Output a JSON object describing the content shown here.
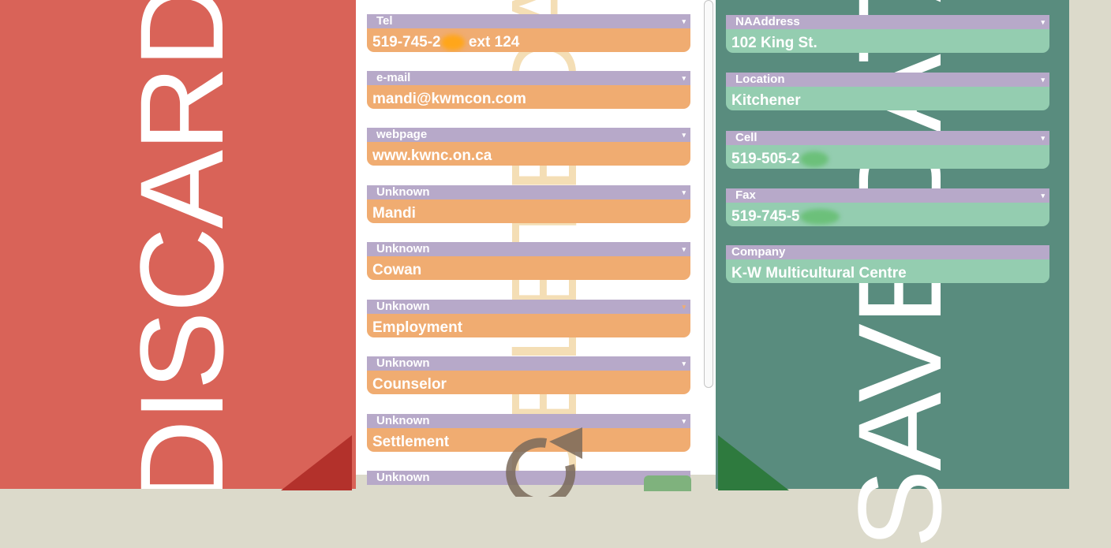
{
  "discard": {
    "label": "DISCARD"
  },
  "save": {
    "label": "SAVE DATA"
  },
  "watermark": {
    "label": "DELETE DATA"
  },
  "left_fields": [
    {
      "label": "Tel",
      "value": "519-745-2",
      "suffix": "ext 124"
    },
    {
      "label": "e-mail",
      "value": "mandi@kwmcon.com"
    },
    {
      "label": "webpage",
      "value": "www.kwnc.on.ca"
    },
    {
      "label": "Unknown",
      "value": "Mandi"
    },
    {
      "label": "Unknown",
      "value": "Cowan"
    },
    {
      "label": "Unknown",
      "value": "Employment"
    },
    {
      "label": "Unknown",
      "value": "Counselor"
    },
    {
      "label": "Unknown",
      "value": "Settlement"
    },
    {
      "label": "Unknown",
      "value": ""
    }
  ],
  "right_fields": [
    {
      "label": "NAAddress",
      "value": "102 King St."
    },
    {
      "label": "Location",
      "value": "Kitchener"
    },
    {
      "label": "Cell",
      "value": "519-505-2"
    },
    {
      "label": "Fax",
      "value": "519-745-5"
    },
    {
      "label": "Company",
      "value": "K-W Multicultural Centre"
    }
  ],
  "icons": {
    "dropdown": "▾",
    "refresh": "refresh-icon"
  },
  "colors": {
    "discard": "#d96358",
    "save": "#598c7e",
    "field_label": "#b7a9c9",
    "field_value_left": "#f0ac71",
    "field_value_right": "#94cdb0"
  }
}
